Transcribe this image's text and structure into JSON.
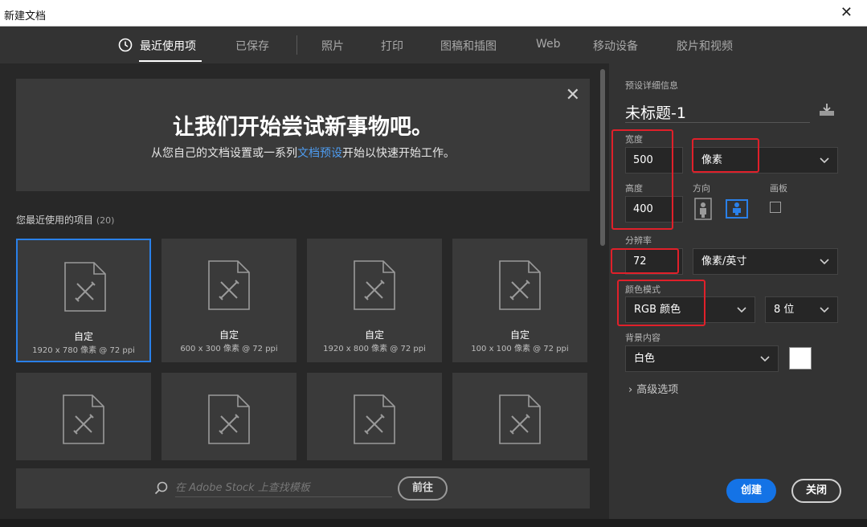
{
  "window": {
    "title": "新建文档",
    "close": "✕"
  },
  "tabs": [
    {
      "label": "最近使用项",
      "active": true
    },
    {
      "label": "已保存"
    },
    {
      "label": "照片"
    },
    {
      "label": "打印"
    },
    {
      "label": "图稿和插图"
    },
    {
      "label": "Web"
    },
    {
      "label": "移动设备"
    },
    {
      "label": "胶片和视频"
    }
  ],
  "banner": {
    "title": "让我们开始尝试新事物吧。",
    "sub_before": "从您自己的文档设置或一系列",
    "sub_link": "文档预设",
    "sub_after": "开始以快速开始工作。",
    "close": "✕"
  },
  "recent": {
    "label": "您最近使用的项目",
    "count": "(20)",
    "items": [
      {
        "name": "自定",
        "dim": "1920 x 780 像素 @ 72 ppi",
        "selected": true
      },
      {
        "name": "自定",
        "dim": "600 x 300 像素 @ 72 ppi"
      },
      {
        "name": "自定",
        "dim": "1920 x 800 像素 @ 72 ppi"
      },
      {
        "name": "自定",
        "dim": "100 x 100 像素 @ 72 ppi"
      },
      {
        "name": "",
        "dim": ""
      },
      {
        "name": "",
        "dim": ""
      },
      {
        "name": "",
        "dim": ""
      },
      {
        "name": "",
        "dim": ""
      }
    ]
  },
  "search": {
    "placeholder": "在 Adobe Stock 上查找模板",
    "go_label": "前往"
  },
  "preset": {
    "section_label": "预设详细信息",
    "doc_name": "未标题-1",
    "width_label": "宽度",
    "width_value": "500",
    "width_unit": "像素",
    "height_label": "高度",
    "height_value": "400",
    "orientation_label": "方向",
    "artboard_label": "画板",
    "resolution_label": "分辨率",
    "resolution_value": "72",
    "resolution_unit": "像素/英寸",
    "color_mode_label": "颜色模式",
    "color_mode_value": "RGB 颜色",
    "bit_depth_value": "8 位",
    "background_label": "背景内容",
    "background_value": "白色",
    "background_color": "#ffffff",
    "advanced_label": "高级选项"
  },
  "actions": {
    "create_label": "创建",
    "close_label": "关闭"
  },
  "colors": {
    "accent": "#1473e6",
    "highlight": "#e0202a",
    "link": "#4e9cf0"
  }
}
